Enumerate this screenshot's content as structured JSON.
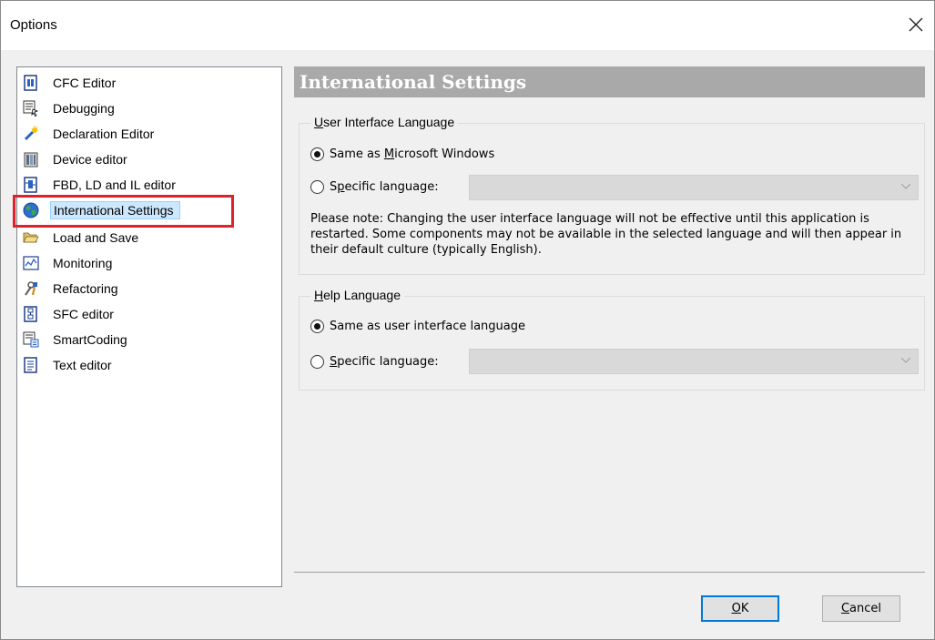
{
  "window": {
    "title": "Options"
  },
  "tree": {
    "items": [
      {
        "label": "CFC Editor",
        "icon": "cfc-editor-icon"
      },
      {
        "label": "Debugging",
        "icon": "debugging-icon"
      },
      {
        "label": "Declaration Editor",
        "icon": "declaration-editor-icon"
      },
      {
        "label": "Device editor",
        "icon": "device-editor-icon"
      },
      {
        "label": "FBD, LD and IL editor",
        "icon": "fbd-ld-il-editor-icon"
      },
      {
        "label": "International Settings",
        "icon": "globe-icon",
        "selected": true
      },
      {
        "label": "Load and Save",
        "icon": "folder-open-icon"
      },
      {
        "label": "Monitoring",
        "icon": "monitoring-icon"
      },
      {
        "label": "Refactoring",
        "icon": "refactoring-icon"
      },
      {
        "label": "SFC editor",
        "icon": "sfc-editor-icon"
      },
      {
        "label": "SmartCoding",
        "icon": "smartcoding-icon"
      },
      {
        "label": "Text editor",
        "icon": "text-editor-icon"
      }
    ]
  },
  "panel": {
    "header": "International Settings",
    "ui_language": {
      "legend_first": "U",
      "legend_rest": "ser Interface Language",
      "opt_same_pre": "Same as ",
      "opt_same_ul": "M",
      "opt_same_post": "icrosoft Windows",
      "opt_specific_pre": "S",
      "opt_specific_ul": "p",
      "opt_specific_post": "ecific language:",
      "selected": "same",
      "combo_value": "",
      "note": "Please note: Changing the user interface language will not be effective until this application is restarted. Some components may not be available in the selected language and will then appear in their default culture (typically English)."
    },
    "help_language": {
      "legend_first": "H",
      "legend_rest": "elp Language",
      "opt_same": "Same as user interface language",
      "opt_specific_first": "S",
      "opt_specific_rest": "pecific language:",
      "selected": "same",
      "combo_value": ""
    }
  },
  "buttons": {
    "ok_ul": "O",
    "ok_rest": "K",
    "cancel_ul": "C",
    "cancel_rest": "ancel"
  },
  "colors": {
    "selection_bg": "#cce8ff",
    "highlight_box": "#e0202a",
    "header_bg": "#a9a9a9",
    "default_button_border": "#0078d7"
  }
}
